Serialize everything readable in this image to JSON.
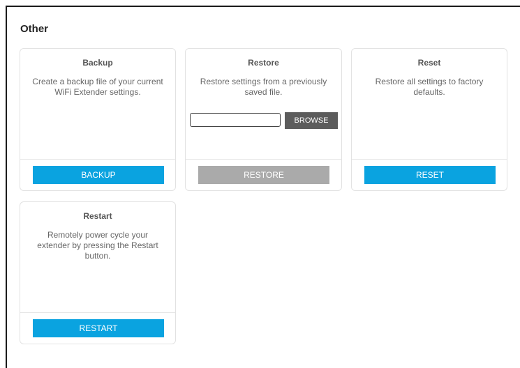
{
  "section": {
    "title": "Other"
  },
  "backup": {
    "title": "Backup",
    "description": "Create a backup file of your current WiFi Extender settings.",
    "button": "BACKUP"
  },
  "restore": {
    "title": "Restore",
    "description": "Restore settings from a previously saved file.",
    "file_value": "",
    "browse_label": "BROWSE",
    "button": "RESTORE"
  },
  "reset": {
    "title": "Reset",
    "description": "Restore all settings to factory defaults.",
    "button": "RESET"
  },
  "restart": {
    "title": "Restart",
    "description": "Remotely power cycle your extender by pressing the Restart button.",
    "button": "RESTART"
  },
  "colors": {
    "primary_button": "#0aa3e0",
    "disabled_button": "#aaaaaa",
    "browse_button": "#5c5c5c"
  }
}
